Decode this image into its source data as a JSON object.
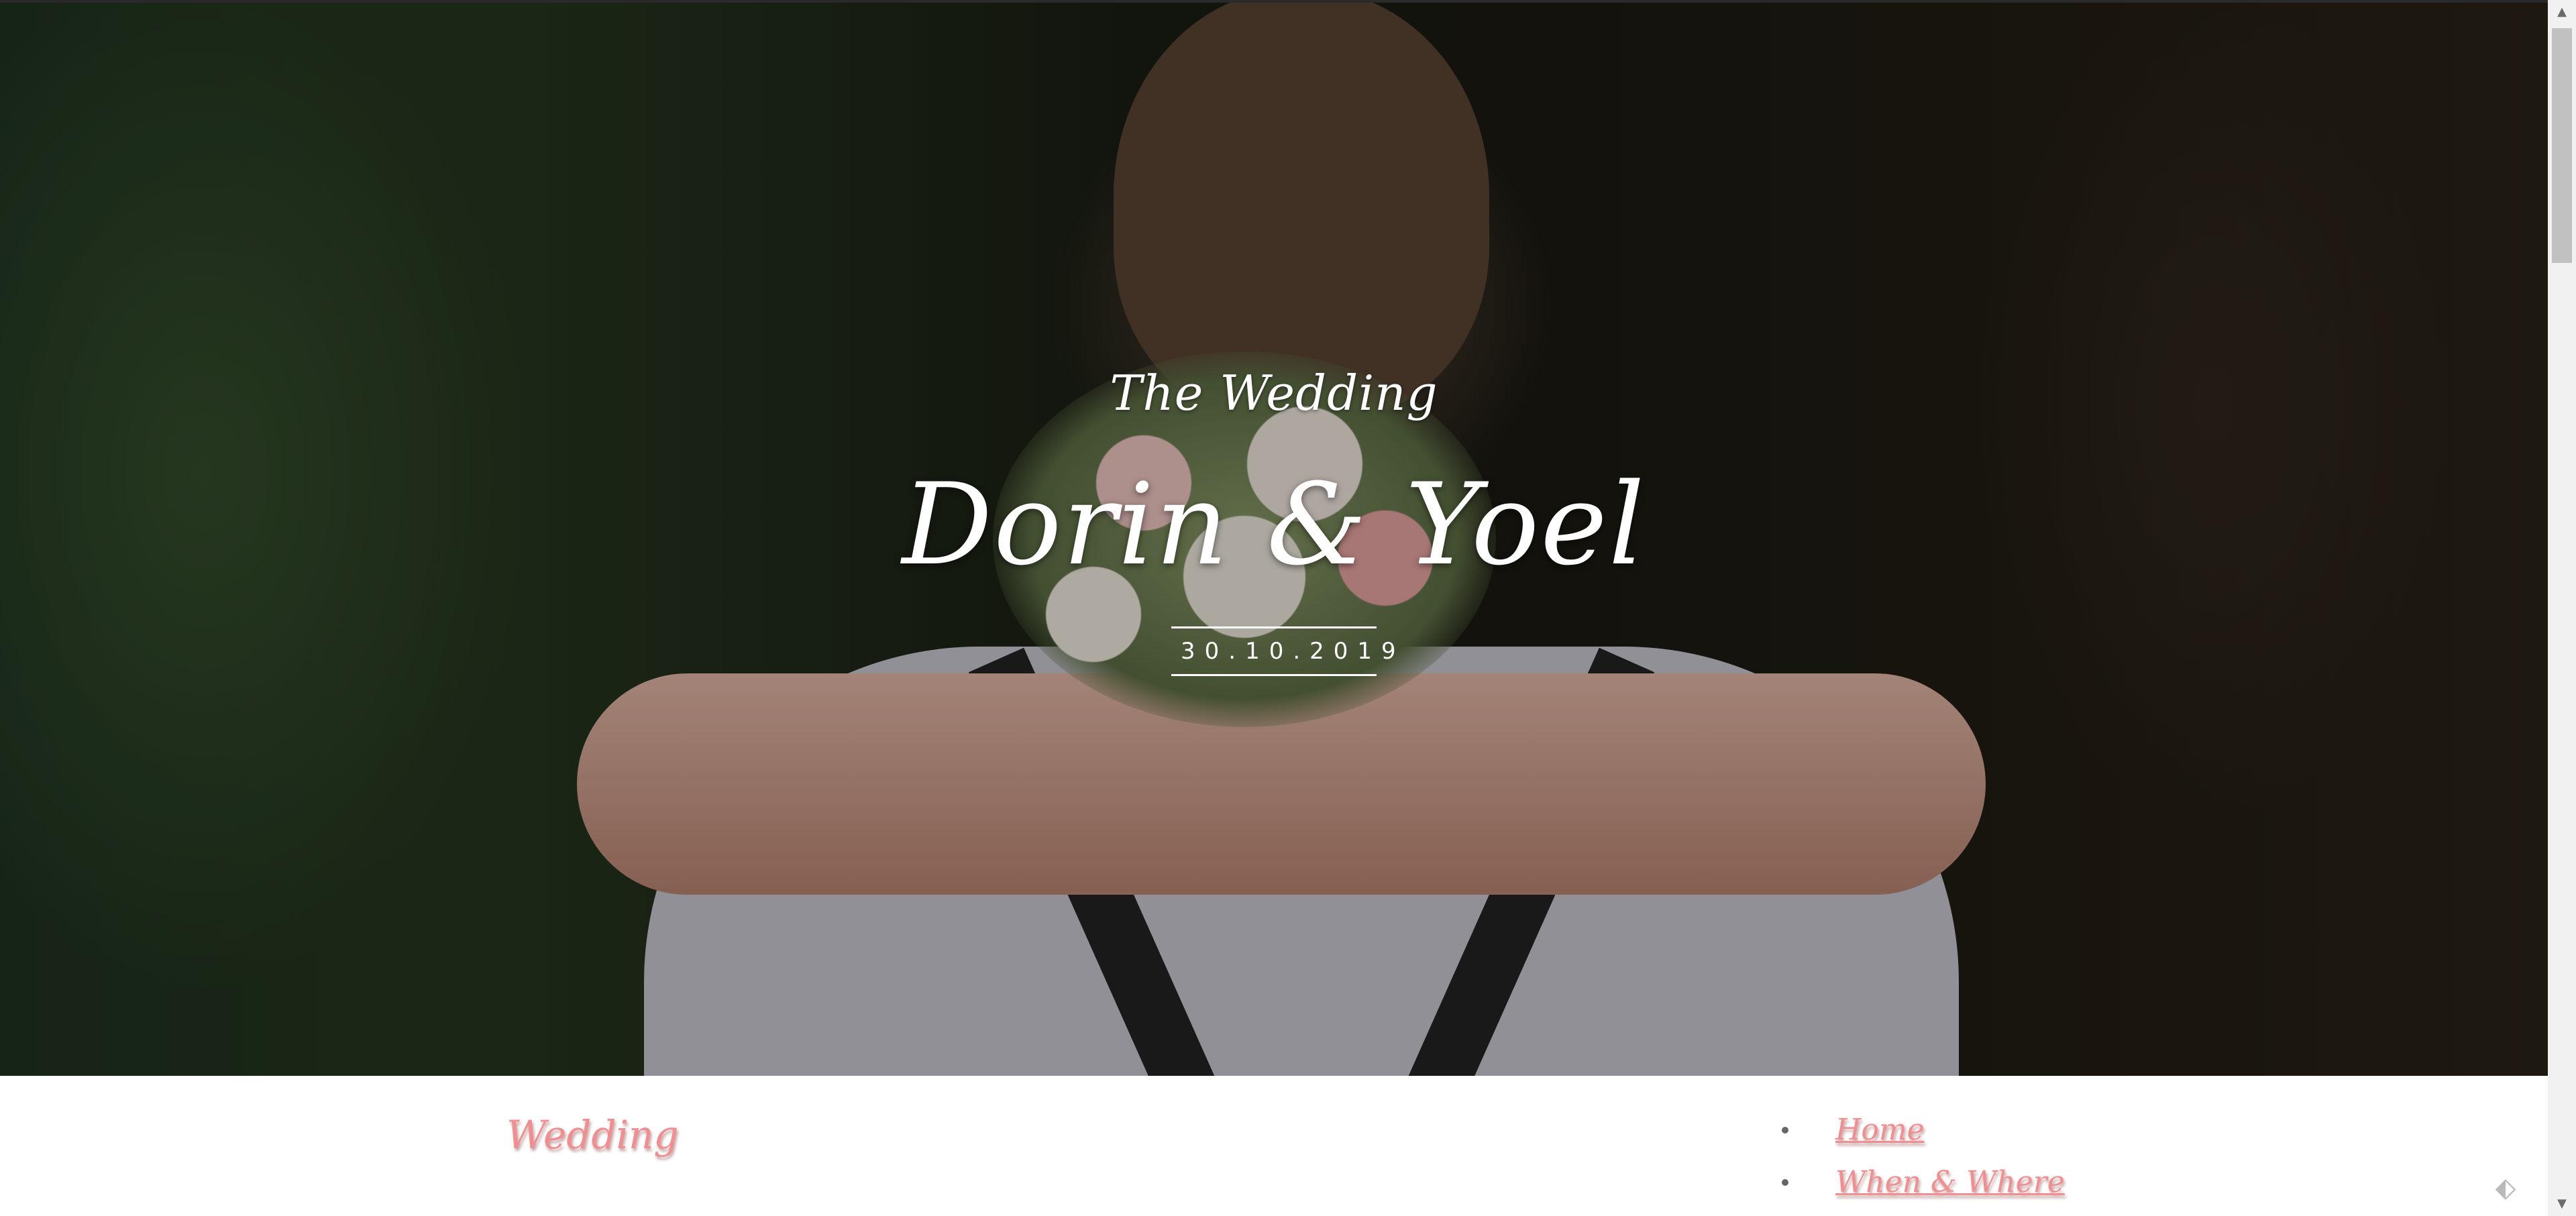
{
  "hero": {
    "subtitle": "The Wedding",
    "names": "Dorin & Yoel",
    "date": "30.10.2019"
  },
  "nav": {
    "brand": "Wedding",
    "items": [
      {
        "label": "Home"
      },
      {
        "label": "When & Where"
      }
    ]
  },
  "scrollbar": {
    "up_icon": "▲",
    "down_icon": "▼"
  },
  "corner_icon": {
    "name": "tag-icon",
    "glyph": "⬖"
  },
  "colors": {
    "accent": "#ef8f92",
    "hero_text": "#ffffff"
  }
}
